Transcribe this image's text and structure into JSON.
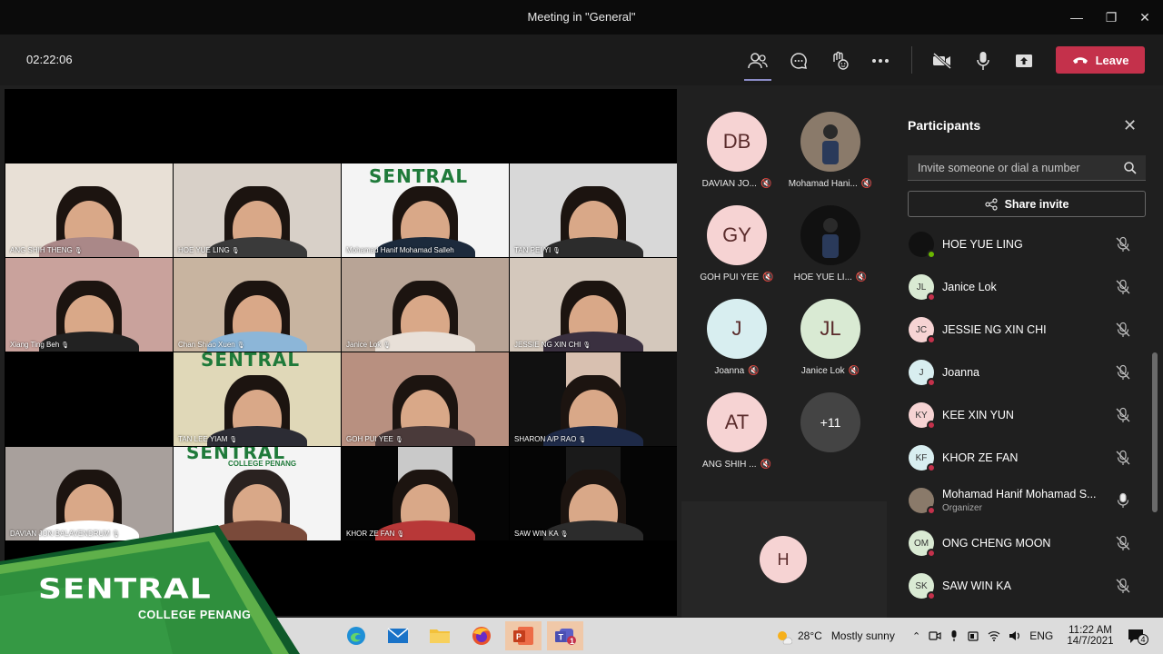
{
  "window": {
    "title": "Meeting in \"General\""
  },
  "toolbar": {
    "timer": "02:22:06",
    "leave_label": "Leave"
  },
  "video_tiles": [
    {
      "name": "ANG SHIH THENG",
      "col": 0,
      "row": 0
    },
    {
      "name": "HOE YUE LING",
      "col": 1,
      "row": 0
    },
    {
      "name": "Mohamad Hanif Mohamad Salleh",
      "col": 2,
      "row": 0
    },
    {
      "name": "TAN PEI YI",
      "col": 3,
      "row": 0
    },
    {
      "name": "Xiang Ting Beh",
      "col": 0,
      "row": 1
    },
    {
      "name": "Chan Shiao Xuen",
      "col": 1,
      "row": 1
    },
    {
      "name": "Janice Lok",
      "col": 2,
      "row": 1
    },
    {
      "name": "JESSIE NG XIN CHI",
      "col": 3,
      "row": 1
    },
    {
      "name": "TAN LEE YIAM",
      "col": 1,
      "row": 2
    },
    {
      "name": "GOH PUI YEE",
      "col": 2,
      "row": 2
    },
    {
      "name": "SHARON A/P RAO",
      "col": 3,
      "row": 2
    },
    {
      "name": "DAVIAN JON BALAVENDRUM",
      "col": 0,
      "row": 3
    },
    {
      "name": "KHOR ZE FAN",
      "col": 2,
      "row": 3
    },
    {
      "name": "SAW WIN KA",
      "col": 3,
      "row": 3
    }
  ],
  "tile_brand": {
    "line1": "SENTRAL",
    "line2": "COLLEGE PENANG"
  },
  "roster": [
    {
      "initials": "DB",
      "label": "DAVIAN JO...",
      "color": "#f6d3d3"
    },
    {
      "initials": "",
      "label": "Mohamad Hani...",
      "color": "#8a7a6a"
    },
    {
      "initials": "GY",
      "label": "GOH PUI YEE",
      "color": "#f6d3d3"
    },
    {
      "initials": "",
      "label": "HOE YUE LI...",
      "color": "#111111"
    },
    {
      "initials": "J",
      "label": "Joanna",
      "color": "#d8eef0"
    },
    {
      "initials": "JL",
      "label": "Janice Lok",
      "color": "#d9ead3"
    },
    {
      "initials": "AT",
      "label": "ANG SHIH ...",
      "color": "#f6d3d3"
    },
    {
      "initials": "+11",
      "label": "",
      "color": "#444444"
    }
  ],
  "own_video": {
    "initials": "H"
  },
  "participants_panel": {
    "title": "Participants",
    "invite_placeholder": "Invite someone or dial a number",
    "share_label": "Share invite",
    "people": [
      {
        "initials": "",
        "name": "HOE YUE LING",
        "role": "",
        "color": "#111111",
        "status": "green",
        "mic": "muted"
      },
      {
        "initials": "JL",
        "name": "Janice Lok",
        "role": "",
        "color": "#d9ead3",
        "status": "red",
        "mic": "muted"
      },
      {
        "initials": "JC",
        "name": "JESSIE NG XIN CHI",
        "role": "",
        "color": "#f6d3d3",
        "status": "red",
        "mic": "muted"
      },
      {
        "initials": "J",
        "name": "Joanna",
        "role": "",
        "color": "#d8eef0",
        "status": "red",
        "mic": "muted"
      },
      {
        "initials": "KY",
        "name": "KEE XIN YUN",
        "role": "",
        "color": "#f6d3d3",
        "status": "red",
        "mic": "muted"
      },
      {
        "initials": "KF",
        "name": "KHOR ZE FAN",
        "role": "",
        "color": "#d8eef0",
        "status": "red",
        "mic": "muted"
      },
      {
        "initials": "",
        "name": "Mohamad Hanif Mohamad S...",
        "role": "Organizer",
        "color": "#8a7a6a",
        "status": "red",
        "mic": "on"
      },
      {
        "initials": "OM",
        "name": "ONG CHENG MOON",
        "role": "",
        "color": "#d9ead3",
        "status": "red",
        "mic": "muted"
      },
      {
        "initials": "SK",
        "name": "SAW WIN KA",
        "role": "",
        "color": "#d9ead3",
        "status": "red",
        "mic": "muted"
      }
    ]
  },
  "taskbar": {
    "weather_temp": "28°C",
    "weather_text": "Mostly sunny",
    "lang": "ENG",
    "time": "11:22 AM",
    "date": "14/7/2021",
    "notif_count": "4",
    "teams_badge": "1"
  },
  "banner": {
    "line1": "SENTRAL",
    "line2": "COLLEGE PENANG"
  },
  "colors": {
    "leave": "#c4314b",
    "accent": "#8b8cc7",
    "brand_green": "#2e8b3e"
  }
}
